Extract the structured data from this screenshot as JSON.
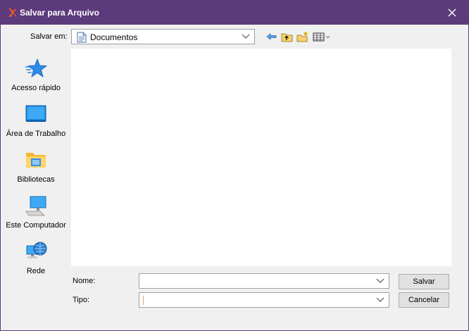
{
  "window": {
    "title": "Salvar para Arquivo"
  },
  "toolbar": {
    "save_in_label": "Salvar em:",
    "save_in_value": "Documentos",
    "icons": [
      "back-arrow-icon",
      "up-folder-icon",
      "new-folder-icon",
      "view-menu-icon"
    ]
  },
  "places": [
    {
      "label": "Acesso rápido",
      "icon": "quick-access-star-icon"
    },
    {
      "label": "Área de Trabalho",
      "icon": "desktop-icon"
    },
    {
      "label": "Bibliotecas",
      "icon": "libraries-folder-icon"
    },
    {
      "label": "Este Computador",
      "icon": "computer-icon"
    },
    {
      "label": "Rede",
      "icon": "network-icon"
    }
  ],
  "form": {
    "name_label": "Nome:",
    "name_value": "",
    "type_label": "Tipo:",
    "type_value": ""
  },
  "buttons": {
    "save": "Salvar",
    "cancel": "Cancelar"
  },
  "colors": {
    "titlebar": "#5c3a7c",
    "accent": "#0078d7"
  }
}
